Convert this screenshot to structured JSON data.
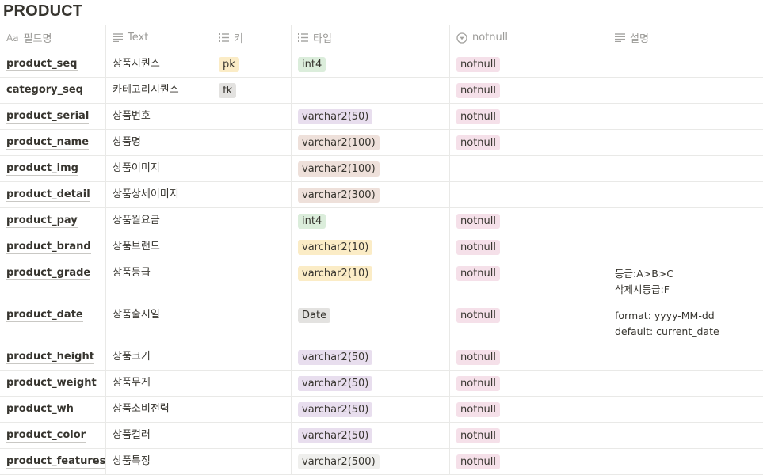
{
  "title": "PRODUCT",
  "columns": [
    {
      "label": "필드명",
      "icon": "title-aa-icon",
      "glyph": "Aa"
    },
    {
      "label": "Text",
      "icon": "text-lines-icon"
    },
    {
      "label": "키",
      "icon": "list-icon"
    },
    {
      "label": "타입",
      "icon": "list-icon"
    },
    {
      "label": "notnull",
      "icon": "select-circle-icon"
    },
    {
      "label": "설명",
      "icon": "text-lines-icon"
    }
  ],
  "tag_colors": {
    "yellow": "#fbecc6",
    "gray": "#e3e2e0",
    "green": "#dbeddb",
    "purple": "#e8deee",
    "brown": "#eee0da",
    "pink": "#f5e0e9",
    "lightgray": "#efefed"
  },
  "rows": [
    {
      "name": "product_seq",
      "text": "상품시퀀스",
      "key": "pk",
      "key_color": "yellow",
      "type": "int4",
      "type_color": "green",
      "notnull": "notnull",
      "desc": []
    },
    {
      "name": "category_seq",
      "text": "카테고리시퀀스",
      "key": "fk",
      "key_color": "gray",
      "type": "",
      "type_color": "",
      "notnull": "notnull",
      "desc": []
    },
    {
      "name": "product_serial",
      "text": "상품번호",
      "key": "",
      "key_color": "",
      "type": "varchar2(50)",
      "type_color": "purple",
      "notnull": "notnull",
      "desc": []
    },
    {
      "name": "product_name",
      "text": "상품명",
      "key": "",
      "key_color": "",
      "type": "varchar2(100)",
      "type_color": "brown",
      "notnull": "notnull",
      "desc": []
    },
    {
      "name": "product_img",
      "text": "상품이미지",
      "key": "",
      "key_color": "",
      "type": "varchar2(100)",
      "type_color": "brown",
      "notnull": "",
      "desc": []
    },
    {
      "name": "product_detail",
      "text": "상품상세이미지",
      "key": "",
      "key_color": "",
      "type": "varchar2(300)",
      "type_color": "brown",
      "notnull": "",
      "desc": []
    },
    {
      "name": "product_pay",
      "text": "상품월요금",
      "key": "",
      "key_color": "",
      "type": "int4",
      "type_color": "green",
      "notnull": "notnull",
      "desc": []
    },
    {
      "name": "product_brand",
      "text": "상품브랜드",
      "key": "",
      "key_color": "",
      "type": "varchar2(10)",
      "type_color": "yellow",
      "notnull": "notnull",
      "desc": []
    },
    {
      "name": "product_grade",
      "text": "상품등급",
      "key": "",
      "key_color": "",
      "type": "varchar2(10)",
      "type_color": "yellow",
      "notnull": "notnull",
      "desc": [
        "등급:A>B>C",
        "삭제시등급:F"
      ]
    },
    {
      "name": "product_date",
      "text": "상품출시일",
      "key": "",
      "key_color": "",
      "type": "Date",
      "type_color": "gray",
      "notnull": "notnull",
      "desc": [
        "format: yyyy-MM-dd",
        "default: current_date"
      ]
    },
    {
      "name": "product_height",
      "text": "상품크기",
      "key": "",
      "key_color": "",
      "type": "varchar2(50)",
      "type_color": "purple",
      "notnull": "notnull",
      "desc": []
    },
    {
      "name": "product_weight",
      "text": "상품무게",
      "key": "",
      "key_color": "",
      "type": "varchar2(50)",
      "type_color": "purple",
      "notnull": "notnull",
      "desc": []
    },
    {
      "name": "product_wh",
      "text": "상품소비전력",
      "key": "",
      "key_color": "",
      "type": "varchar2(50)",
      "type_color": "purple",
      "notnull": "notnull",
      "desc": []
    },
    {
      "name": "product_color",
      "text": "상품컬러",
      "key": "",
      "key_color": "",
      "type": "varchar2(50)",
      "type_color": "purple",
      "notnull": "notnull",
      "desc": []
    },
    {
      "name": "product_features",
      "text": "상품특징",
      "key": "",
      "key_color": "",
      "type": "varchar2(500)",
      "type_color": "lightgray",
      "notnull": "notnull",
      "desc": []
    }
  ]
}
